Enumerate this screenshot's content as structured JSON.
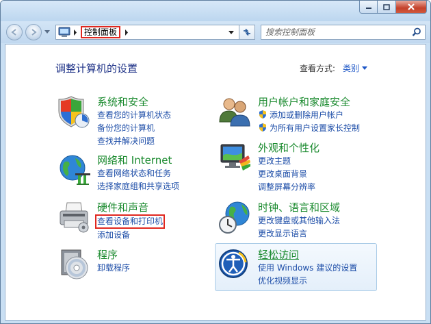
{
  "nav": {
    "breadcrumb": "控制面板",
    "search_placeholder": "搜索控制面板"
  },
  "main": {
    "title": "调整计算机的设置",
    "view_by_label": "查看方式:",
    "view_by_value": "类别"
  },
  "categories": [
    {
      "title": "系统和安全",
      "icon": "shield-icon",
      "links": [
        "查看您的计算机状态",
        "备份您的计算机",
        "查找并解决问题"
      ]
    },
    {
      "title": "网络和 Internet",
      "icon": "globe-network-icon",
      "links": [
        "查看网络状态和任务",
        "选择家庭组和共享选项"
      ]
    },
    {
      "title": "硬件和声音",
      "icon": "printer-icon",
      "links": [
        "查看设备和打印机",
        "添加设备"
      ]
    },
    {
      "title": "程序",
      "icon": "disc-icon",
      "links": [
        "卸载程序"
      ]
    },
    {
      "title": "用户帐户和家庭安全",
      "icon": "users-icon",
      "links": [
        "添加或删除用户帐户",
        "为所有用户设置家长控制"
      ]
    },
    {
      "title": "外观和个性化",
      "icon": "monitor-palette-icon",
      "links": [
        "更改主题",
        "更改桌面背景",
        "调整屏幕分辨率"
      ]
    },
    {
      "title": "时钟、语言和区域",
      "icon": "globe-clock-icon",
      "links": [
        "更改键盘或其他输入法",
        "更改显示语言"
      ]
    },
    {
      "title": "轻松访问",
      "icon": "accessibility-icon",
      "links": [
        "使用 Windows 建议的设置",
        "优化视频显示"
      ]
    }
  ],
  "colors": {
    "category_title": "#1a8a2e",
    "link": "#1e4ea8",
    "page_title": "#1e3287",
    "highlight": "#e0271f"
  }
}
